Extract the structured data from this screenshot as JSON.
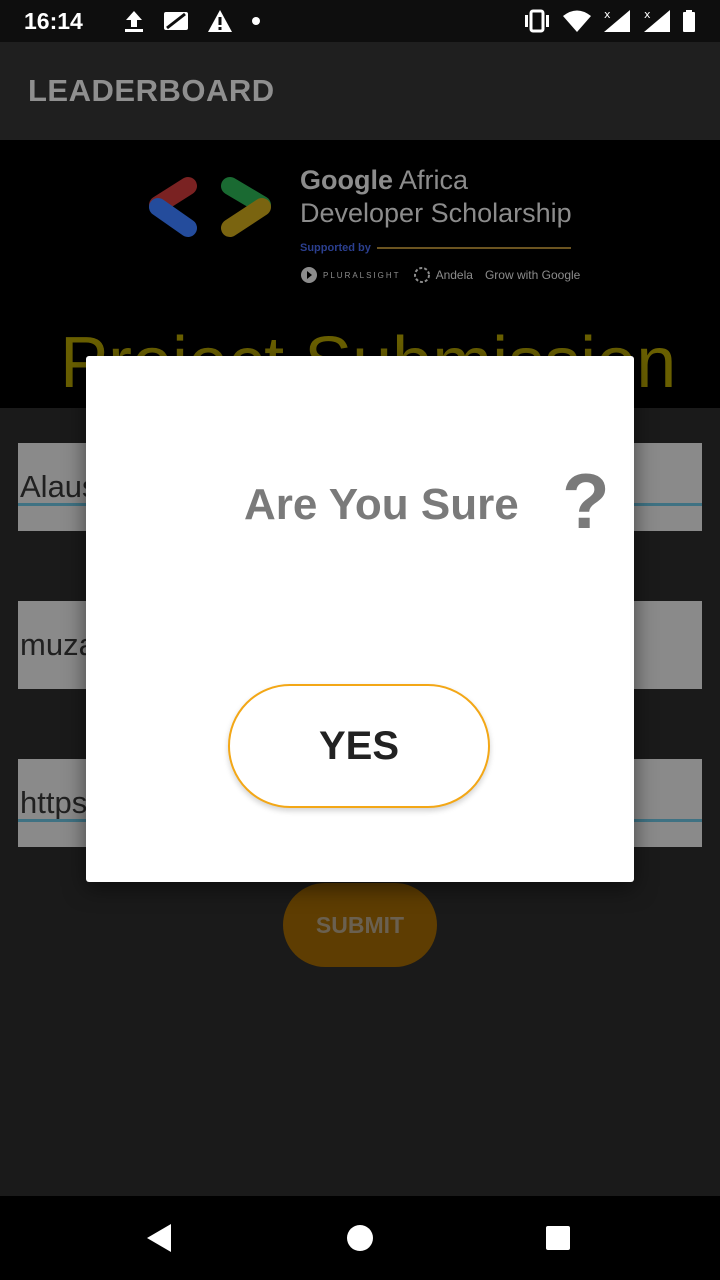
{
  "status_bar": {
    "time": "16:14",
    "icons_left": [
      "upload-icon",
      "no-sim-icon",
      "warning-icon",
      "dot-icon"
    ],
    "icons_right": [
      "vibrate-icon",
      "wifi-icon",
      "signal-icon",
      "signal-icon",
      "battery-icon"
    ],
    "signal_badge": "x"
  },
  "app_bar": {
    "title": "LEADERBOARD"
  },
  "banner": {
    "brand_line1_strong": "Google",
    "brand_line1_rest": " Africa",
    "brand_line2": "Developer Scholarship",
    "supported_label": "Supported by",
    "partners": [
      "PLURALSIGHT",
      "Andela",
      "Grow with Google"
    ],
    "section_title": "Project Submission"
  },
  "form": {
    "fields": [
      {
        "value": "Alaus"
      },
      {
        "value": "muza"
      },
      {
        "value": "https"
      }
    ],
    "submit_label": "SUBMIT"
  },
  "dialog": {
    "title": "Are You Sure",
    "question_mark": "?",
    "confirm_label": "YES"
  },
  "colors": {
    "accent": "#F3A716",
    "banner_title": "#695F00",
    "dialog_text": "#7A7A7A"
  }
}
